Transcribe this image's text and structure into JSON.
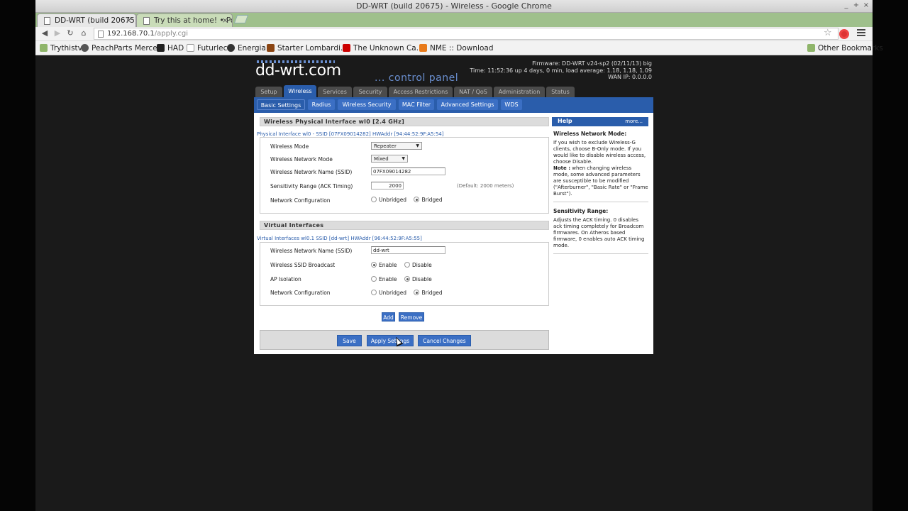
{
  "window": {
    "title": "DD-WRT (build 20675) - Wireless - Google Chrome"
  },
  "tabs": [
    {
      "label": "DD-WRT (build 20675)",
      "active": true
    },
    {
      "label": "Try this at home! • Port",
      "active": false
    }
  ],
  "toolbar": {
    "url_host": "192.168.70.1",
    "url_path": "/apply.cgi"
  },
  "bookmarks": [
    {
      "label": "Trythistv",
      "icon": "folder-icon",
      "color": "#8fb56a"
    },
    {
      "label": "PeachParts Merce...",
      "icon": "mercedes-icon",
      "color": "#555555"
    },
    {
      "label": "HAD",
      "icon": "had-icon",
      "color": "#222222"
    },
    {
      "label": "Futurlec",
      "icon": "page-icon",
      "color": "#dddddd"
    },
    {
      "label": "Energia",
      "icon": "github-icon",
      "color": "#333333"
    },
    {
      "label": "Starter Lombardi...",
      "icon": "building-icon",
      "color": "#8b4513"
    },
    {
      "label": "The Unknown Ca...",
      "icon": "youtube-icon",
      "color": "#cc0000"
    },
    {
      "label": "NME :: Download",
      "icon": "nme-icon",
      "color": "#e87a1a"
    },
    {
      "label": "Other Bookmarks",
      "icon": "folder-icon",
      "color": "#8fb56a"
    }
  ],
  "ddwrt": {
    "logo": "dd-wrt.com",
    "logo_sub": "... control panel",
    "firmware": "Firmware: DD-WRT v24-sp2 (02/11/13) big",
    "time": "Time: 11:52:36 up 4 days, 0 min, load average: 1.18, 1.18, 1.09",
    "wan_ip": "WAN IP: 0.0.0.0",
    "main_tabs": [
      "Setup",
      "Wireless",
      "Services",
      "Security",
      "Access Restrictions",
      "NAT / QoS",
      "Administration",
      "Status"
    ],
    "sub_tabs": [
      "Basic Settings",
      "Radius",
      "Wireless Security",
      "MAC Filter",
      "Advanced Settings",
      "WDS"
    ],
    "physical": {
      "heading": "Wireless Physical Interface wl0 [2.4 GHz]",
      "iface": "Physical Interface wl0 - SSID [07FX09014282] HWAddr [94:44:52:9F:A5:54]",
      "mode_label": "Wireless Mode",
      "mode_value": "Repeater",
      "net_mode_label": "Wireless Network Mode",
      "net_mode_value": "Mixed",
      "ssid_label": "Wireless Network Name (SSID)",
      "ssid_value": "07FX09014282",
      "sens_label": "Sensitivity Range (ACK Timing)",
      "sens_value": "2000",
      "sens_hint": "(Default: 2000 meters)",
      "netcfg_label": "Network Configuration",
      "unbridged": "Unbridged",
      "bridged": "Bridged"
    },
    "virtual": {
      "heading": "Virtual Interfaces",
      "iface": "Virtual Interfaces wl0.1 SSID [dd-wrt] HWAddr [96:44:52:9F:A5:55]",
      "ssid_label": "Wireless Network Name (SSID)",
      "ssid_value": "dd-wrt",
      "broadcast_label": "Wireless SSID Broadcast",
      "enable": "Enable",
      "disable": "Disable",
      "isolation_label": "AP Isolation",
      "netcfg_label": "Network Configuration",
      "unbridged": "Unbridged",
      "bridged": "Bridged"
    },
    "add": "Add",
    "remove": "Remove",
    "save": "Save",
    "apply": "Apply Settings",
    "cancel": "Cancel Changes",
    "help": {
      "title": "Help",
      "more": "more...",
      "mode_title": "Wireless Network Mode:",
      "mode_text": "If you wish to exclude Wireless-G clients, choose B-Only mode. If you would like to disable wireless access, choose Disable.",
      "mode_note_label": "Note :",
      "mode_note": "when changing wireless mode, some advanced parameters are susceptible to be modified (\"Afterburner\", \"Basic Rate\" or \"Frame Burst\").",
      "sens_title": "Sensitivity Range:",
      "sens_text": "Adjusts the ACK timing. 0 disables ack timing completely for Broadcom firmwares. On Atheros based firmware, 0 enables auto ACK timing mode."
    }
  }
}
